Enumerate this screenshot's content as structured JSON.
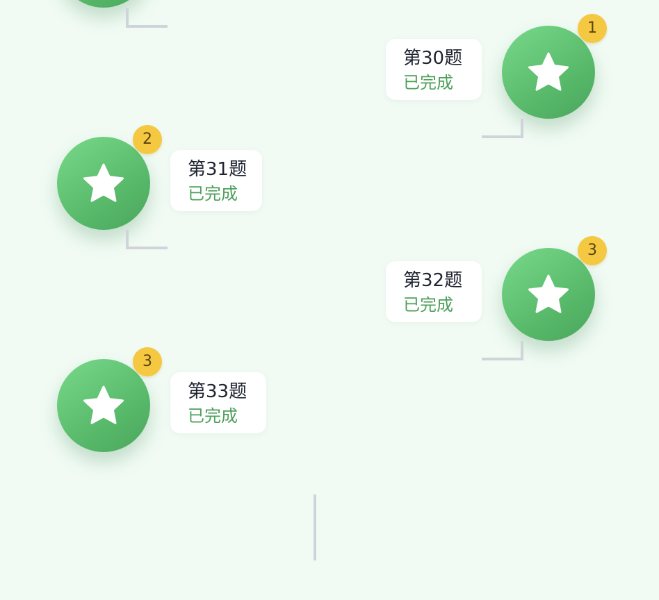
{
  "colors": {
    "background": "#f1fbf4",
    "node_green": "#5bbd6d",
    "badge_yellow": "#f5c842",
    "status_green": "#4c9f5a",
    "connector_gray": "#d0d4da"
  },
  "levels": [
    {
      "title": "第30题",
      "status": "已完成",
      "stars": "1",
      "icon": "star-icon"
    },
    {
      "title": "第31题",
      "status": "已完成",
      "stars": "2",
      "icon": "star-icon"
    },
    {
      "title": "第32题",
      "status": "已完成",
      "stars": "3",
      "icon": "star-icon"
    },
    {
      "title": "第33题",
      "status": "已完成",
      "stars": "3",
      "icon": "star-icon"
    }
  ]
}
